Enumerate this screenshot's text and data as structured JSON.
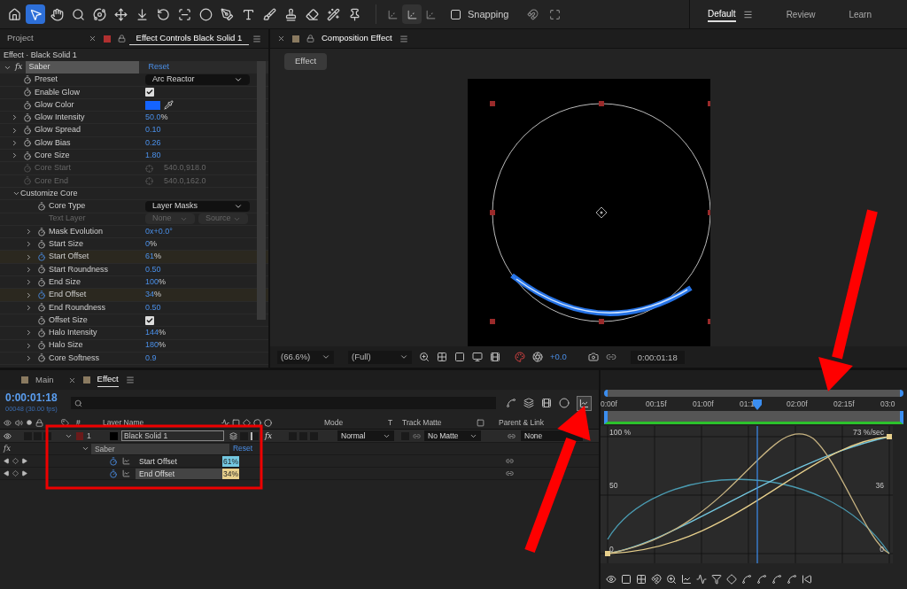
{
  "toolbar": {
    "tools": [
      {
        "selected": false
      },
      {
        "selected": true
      },
      {
        "selected": false
      },
      {
        "selected": false
      },
      {
        "selected": false
      },
      {
        "selected": false
      },
      {
        "selected": false
      },
      {
        "selected": false
      },
      {
        "selected": false
      },
      {
        "selected": false
      },
      {
        "selected": false
      },
      {
        "selected": false
      },
      {
        "selected": false
      },
      {
        "selected": false
      },
      {
        "selected": false
      },
      {
        "selected": false
      },
      {
        "selected": false
      }
    ],
    "snapping": {
      "label": "Snapping",
      "checked": false
    },
    "workspaces": [
      {
        "label": "Default",
        "selected": true
      },
      {
        "label": "Review",
        "selected": false
      },
      {
        "label": "Learn",
        "selected": false
      }
    ]
  },
  "effect_controls": {
    "tabs": [
      {
        "label": "Project",
        "selected": false
      },
      {
        "label": "Effect Controls Black Solid 1",
        "selected": true
      }
    ],
    "subtitle": "Effect · Black Solid 1",
    "effect": {
      "fx": "fx",
      "name": "Saber",
      "reset": "Reset",
      "params": [
        {
          "kind": "dropdown",
          "label": "Preset",
          "value": "Arc Reactor"
        },
        {
          "kind": "checkbox",
          "label": "Enable Glow",
          "checked": true
        },
        {
          "kind": "color",
          "label": "Glow Color",
          "color": "#1464ff"
        },
        {
          "kind": "number",
          "label": "Glow Intensity",
          "value": "50.0",
          "unit": "%",
          "keyframed": false
        },
        {
          "kind": "number",
          "label": "Glow Spread",
          "value": "0.10",
          "keyframed": false
        },
        {
          "kind": "number",
          "label": "Glow Bias",
          "value": "0.26",
          "keyframed": false
        },
        {
          "kind": "number",
          "label": "Core Size",
          "value": "1.80",
          "keyframed": false
        },
        {
          "kind": "point",
          "label": "Core Start",
          "value": "540.0,918.0"
        },
        {
          "kind": "point",
          "label": "Core End",
          "value": "540.0,162.0"
        },
        {
          "kind": "group",
          "label": "Customize Core",
          "expanded": true,
          "children": [
            {
              "kind": "dropdown",
              "label": "Core Type",
              "value": "Layer Masks"
            },
            {
              "kind": "dropdown_pair",
              "label": "Text Layer",
              "values": [
                "None",
                "Source"
              ]
            },
            {
              "kind": "number",
              "label": "Mask Evolution",
              "value": "0x+0.0°",
              "keyframed": false
            },
            {
              "kind": "number",
              "label": "Start Size",
              "value": "0",
              "unit": "%",
              "keyframed": false
            },
            {
              "kind": "number",
              "label": "Start Offset",
              "value": "61",
              "unit": "%",
              "keyframed": true
            },
            {
              "kind": "number",
              "label": "Start Roundness",
              "value": "0.50",
              "keyframed": false
            },
            {
              "kind": "number",
              "label": "End Size",
              "value": "100",
              "unit": "%",
              "keyframed": false
            },
            {
              "kind": "number",
              "label": "End Offset",
              "value": "34",
              "unit": "%",
              "keyframed": true
            },
            {
              "kind": "number",
              "label": "End Roundness",
              "value": "0.50",
              "keyframed": false
            },
            {
              "kind": "checkbox",
              "label": "Offset Size",
              "checked": true
            },
            {
              "kind": "number",
              "label": "Halo Intensity",
              "value": "144",
              "unit": "%",
              "keyframed": false
            },
            {
              "kind": "number",
              "label": "Halo Size",
              "value": "180",
              "unit": "%",
              "keyframed": false
            },
            {
              "kind": "number",
              "label": "Core Softness",
              "value": "0.9",
              "keyframed": false
            }
          ]
        }
      ]
    }
  },
  "composition": {
    "tab": "Composition Effect",
    "button": "Effect",
    "zoom": "(66.6%)",
    "resolution": "(Full)",
    "exposure": "+0.0",
    "timecode": "0:00:01:18"
  },
  "timeline": {
    "tabs": [
      {
        "label": "Main",
        "selected": false
      },
      {
        "label": "Effect",
        "selected": true
      }
    ],
    "timecode": "0:00:01:18",
    "frame_info": "00048 (30.00 fps)",
    "columns": {
      "number": "#",
      "layer_name": "Layer Name",
      "mode": "Mode",
      "t": "T",
      "track_matte": "Track Matte",
      "parent": "Parent & Link"
    },
    "layer": {
      "number": "1",
      "name": "Black Solid 1",
      "quality_on": true,
      "fx": "fx",
      "fx_on": true,
      "mode": "Normal",
      "track_matte": "No Matte",
      "parent": "None"
    },
    "effect": {
      "fx": "fx",
      "name": "Saber",
      "reset": "Reset"
    },
    "properties": [
      {
        "label": "Start Offset",
        "value": "61%",
        "color": "#74c8e0",
        "selected": false
      },
      {
        "label": "End Offset",
        "value": "34%",
        "color": "#e8d08c",
        "selected": true
      }
    ]
  },
  "graph_editor": {
    "time_ticks": [
      "0:00f",
      "00:15f",
      "01:00f",
      "01:1",
      "02:00f",
      "02:15f",
      "03:0"
    ],
    "left_labels": [
      "100 %",
      "50",
      "0"
    ],
    "right_labels": [
      "73 %/sec",
      "36",
      "0"
    ]
  }
}
